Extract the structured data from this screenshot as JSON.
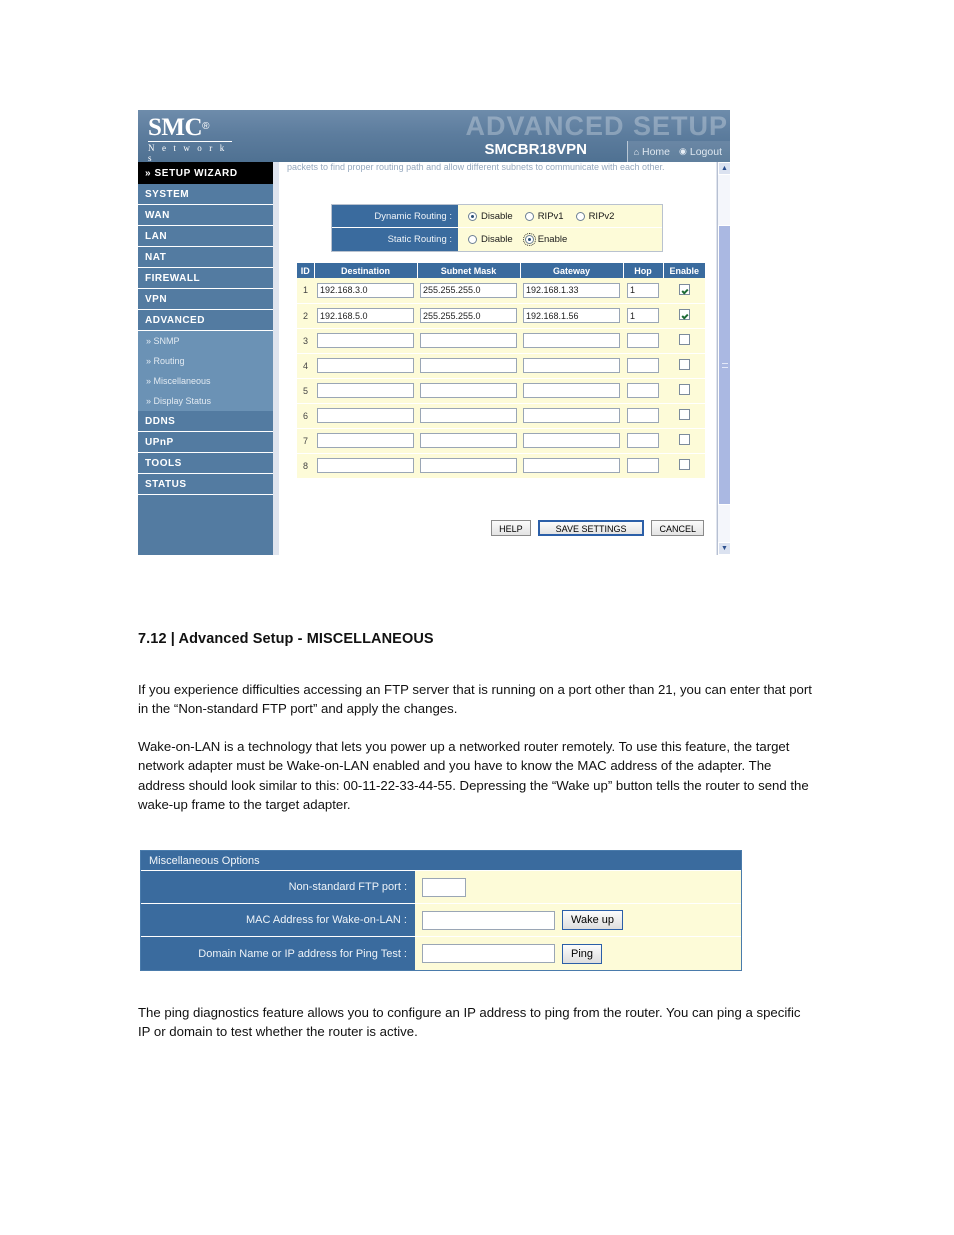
{
  "router_ui": {
    "brand": {
      "logo_main": "SMC",
      "logo_reg": "®",
      "logo_sub": "N e t w o r k s"
    },
    "header": {
      "watermark": "ADVANCED SETUP",
      "model": "SMCBR18VPN",
      "nav": [
        {
          "icon": "home-icon",
          "glyph": "⌂",
          "label": "Home"
        },
        {
          "icon": "logout-icon",
          "glyph": "◉",
          "label": "Logout"
        }
      ]
    },
    "sidebar": {
      "wizard": "» SETUP WIZARD",
      "items": [
        {
          "label": "SYSTEM"
        },
        {
          "label": "WAN"
        },
        {
          "label": "LAN"
        },
        {
          "label": "NAT"
        },
        {
          "label": "FIREWALL"
        },
        {
          "label": "VPN"
        },
        {
          "label": "ADVANCED"
        }
      ],
      "sub_items": [
        {
          "label": "» SNMP"
        },
        {
          "label": "» Routing"
        },
        {
          "label": "» Miscellaneous"
        },
        {
          "label": "» Display Status"
        }
      ],
      "items_after": [
        {
          "label": "DDNS"
        },
        {
          "label": "UPnP"
        },
        {
          "label": "TOOLS"
        },
        {
          "label": "STATUS"
        }
      ]
    },
    "content": {
      "clipped_note": "packets to find proper routing path and allow different subnets to communicate with each other.",
      "dynamic_routing": {
        "label": "Dynamic Routing :",
        "options": [
          {
            "label": "Disable",
            "selected": true
          },
          {
            "label": "RIPv1",
            "selected": false
          },
          {
            "label": "RIPv2",
            "selected": false
          }
        ]
      },
      "static_routing": {
        "label": "Static Routing :",
        "options": [
          {
            "label": "Disable",
            "selected": false
          },
          {
            "label": "Enable",
            "selected": true,
            "focused": true
          }
        ]
      },
      "routing_table": {
        "columns": [
          "ID",
          "Destination",
          "Subnet Mask",
          "Gateway",
          "Hop",
          "Enable"
        ],
        "rows": [
          {
            "id": "1",
            "destination": "192.168.3.0",
            "subnet_mask": "255.255.255.0",
            "gateway": "192.168.1.33",
            "hop": "1",
            "enable": true
          },
          {
            "id": "2",
            "destination": "192.168.5.0",
            "subnet_mask": "255.255.255.0",
            "gateway": "192.168.1.56",
            "hop": "1",
            "enable": true
          },
          {
            "id": "3",
            "destination": "",
            "subnet_mask": "",
            "gateway": "",
            "hop": "",
            "enable": false
          },
          {
            "id": "4",
            "destination": "",
            "subnet_mask": "",
            "gateway": "",
            "hop": "",
            "enable": false
          },
          {
            "id": "5",
            "destination": "",
            "subnet_mask": "",
            "gateway": "",
            "hop": "",
            "enable": false
          },
          {
            "id": "6",
            "destination": "",
            "subnet_mask": "",
            "gateway": "",
            "hop": "",
            "enable": false
          },
          {
            "id": "7",
            "destination": "",
            "subnet_mask": "",
            "gateway": "",
            "hop": "",
            "enable": false
          },
          {
            "id": "8",
            "destination": "",
            "subnet_mask": "",
            "gateway": "",
            "hop": "",
            "enable": false
          }
        ]
      },
      "buttons": {
        "help": "HELP",
        "save": "SAVE SETTINGS",
        "cancel": "CANCEL"
      }
    },
    "scrollbar": {
      "up_glyph": "▲",
      "down_glyph": "▼"
    }
  },
  "document": {
    "heading": "7.12 | Advanced Setup - MISCELLANEOUS",
    "paragraph_1": "If you experience difficulties accessing an FTP server that is running on a port other than 21, you can enter that port in the “Non-standard FTP port” and apply the changes.",
    "paragraph_2": "Wake-on-LAN is a technology that lets you power up a networked router remotely. To use this feature, the target network adapter must be Wake-on-LAN enabled and you have to know the MAC address of the adapter. The address should look similar to this: 00-11-22-33-44-55. Depressing the “Wake up” button tells the router to send the wake-up frame to the target adapter.",
    "paragraph_3": "The ping diagnostics feature allows you to configure an IP address to ping from the router. You can ping a specific IP or domain to test whether the router is active."
  },
  "misc_panel": {
    "title": "Miscellaneous Options",
    "rows": [
      {
        "label": "Non-standard FTP port :",
        "value": "",
        "button": null
      },
      {
        "label": "MAC Address for Wake-on-LAN :",
        "value": "",
        "button": "Wake up"
      },
      {
        "label": "Domain Name or IP address for Ping Test :",
        "value": "",
        "button": "Ping"
      }
    ]
  },
  "colors": {
    "header_blue": "#5d7d9e",
    "sidebar_blue": "#537ba1",
    "sub_blue": "#6b92b5",
    "label_blue": "#3a6b9e",
    "field_yellow": "#fdfbd8",
    "page_bg": "#dfe4ee"
  }
}
